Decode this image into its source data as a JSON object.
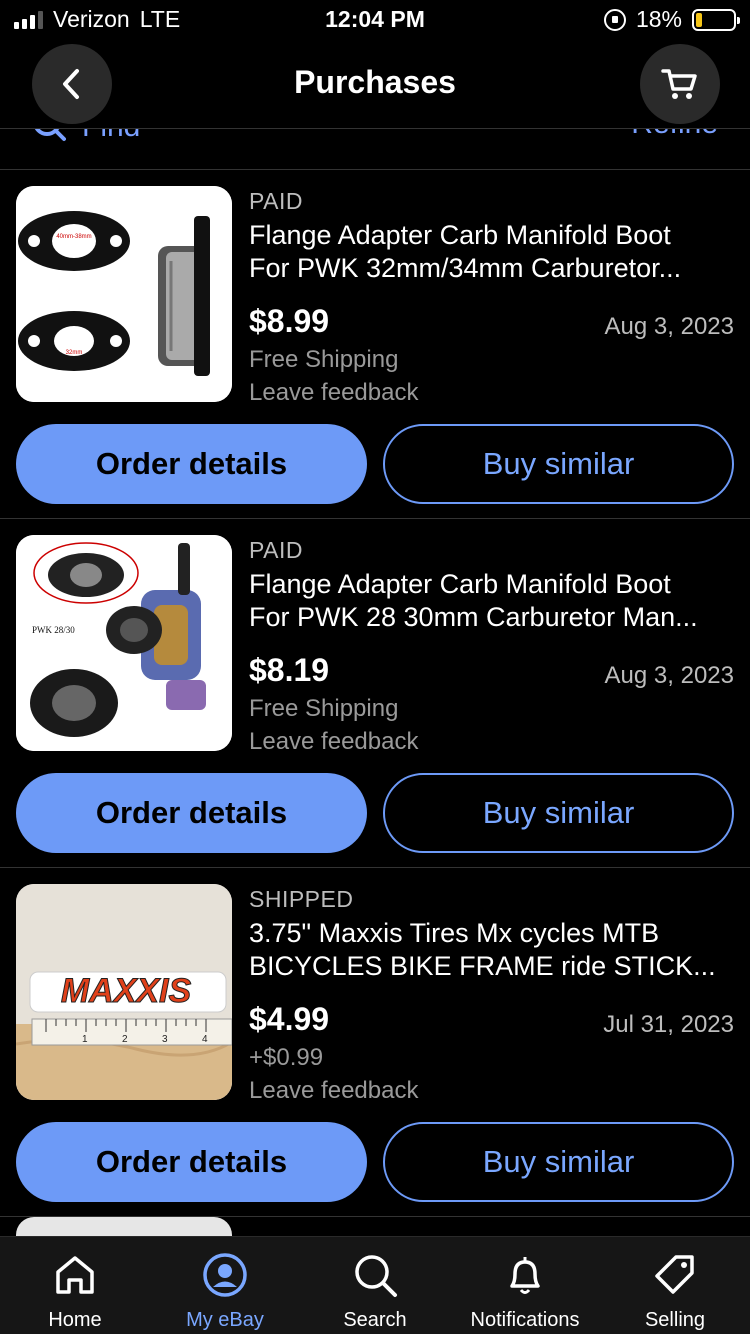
{
  "status_bar": {
    "carrier": "Verizon",
    "network": "LTE",
    "time": "12:04 PM",
    "battery": "18%",
    "battery_level": 0.18
  },
  "header": {
    "title": "Purchases"
  },
  "search_row": {
    "find_label": "Find",
    "refine_label": "Refine"
  },
  "purchases": [
    {
      "status": "PAID",
      "title_line1": "Flange Adapter Carb Manifold Boot",
      "title_line2": "For PWK 32mm/34mm Carburetor...",
      "price": "$8.99",
      "date": "Aug 3, 2023",
      "shipping": "Free Shipping",
      "feedback": "Leave feedback",
      "primary_btn": "Order details",
      "secondary_btn": "Buy similar",
      "thumb_labels": [
        "40mm-38mm",
        "32mm"
      ]
    },
    {
      "status": "PAID",
      "title_line1": "Flange Adapter Carb Manifold Boot",
      "title_line2": "For PWK 28 30mm Carburetor Man...",
      "price": "$8.19",
      "date": "Aug 3, 2023",
      "shipping": "Free Shipping",
      "feedback": "Leave feedback",
      "primary_btn": "Order details",
      "secondary_btn": "Buy similar",
      "thumb_labels": [
        "PWK 28/30"
      ]
    },
    {
      "status": "SHIPPED",
      "title_line1": "3.75\" Maxxis Tires Mx cycles  MTB",
      "title_line2": "BICYCLES BIKE FRAME ride  STICK...",
      "price": "$4.99",
      "date": "Jul 31, 2023",
      "shipping": "+$0.99",
      "feedback": "Leave feedback",
      "primary_btn": "Order details",
      "secondary_btn": "Buy similar",
      "thumb_labels": [
        "MAXXIS",
        "1",
        "2",
        "3",
        "4"
      ]
    }
  ],
  "tabbar": {
    "items": [
      {
        "label": "Home",
        "icon": "home-icon"
      },
      {
        "label": "My eBay",
        "icon": "user-icon",
        "active": true
      },
      {
        "label": "Search",
        "icon": "search-icon"
      },
      {
        "label": "Notifications",
        "icon": "bell-icon"
      },
      {
        "label": "Selling",
        "icon": "tag-icon"
      }
    ]
  },
  "colors": {
    "accent": "#6d9af7",
    "background": "#000000",
    "secondary_text": "#9a9a9a"
  }
}
